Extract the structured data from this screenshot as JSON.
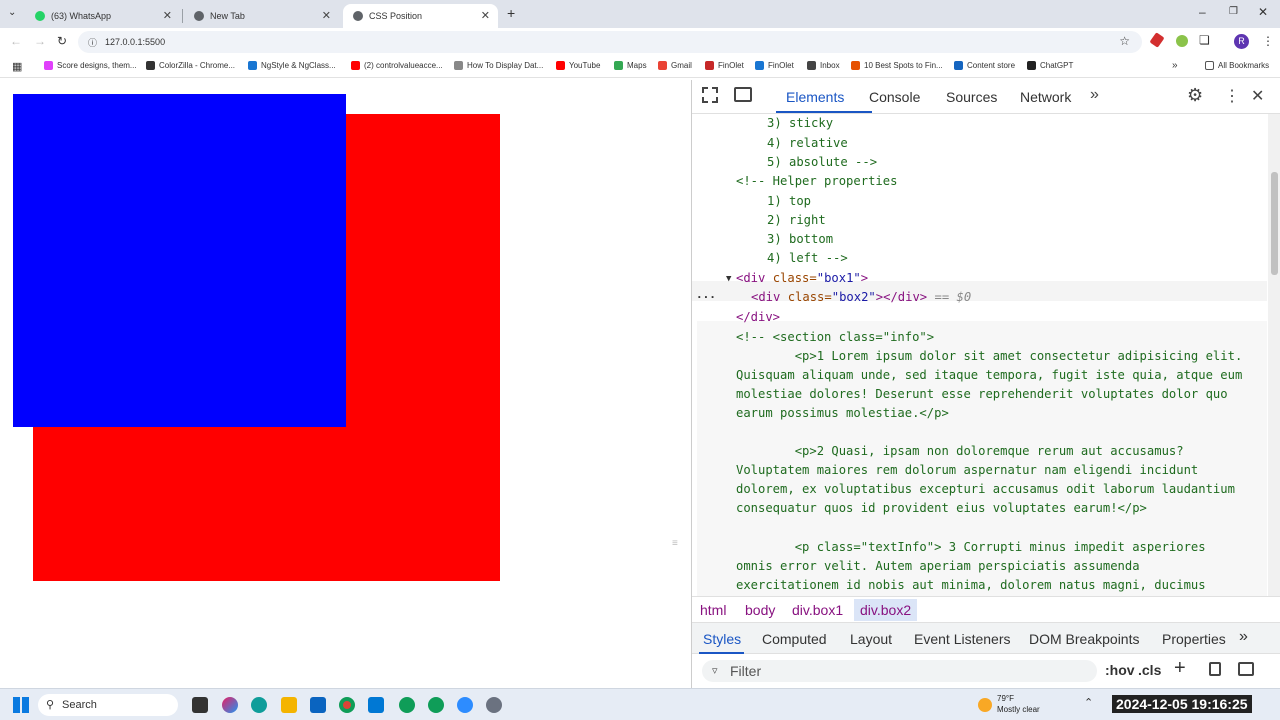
{
  "browser": {
    "tabs": [
      {
        "title": "(63) WhatsApp",
        "color": "#25d366"
      },
      {
        "title": "New Tab",
        "color": "#5f6368"
      },
      {
        "title": "CSS Position",
        "color": "#5f6368"
      }
    ],
    "url": "127.0.0.1:5500",
    "bookmarks": [
      {
        "label": "Score designs, them...",
        "color": "#e040fb"
      },
      {
        "label": "ColorZilla - Chrome...",
        "color": "#333333"
      },
      {
        "label": "NgStyle & NgClass...",
        "color": "#1976d2"
      },
      {
        "label": "(2) controlvalueacce...",
        "color": "#ff0000"
      },
      {
        "label": "How To Display Dat...",
        "color": "#888888"
      },
      {
        "label": "YouTube",
        "color": "#ff0000"
      },
      {
        "label": "Maps",
        "color": "#34a853"
      },
      {
        "label": "Gmail",
        "color": "#ea4335"
      },
      {
        "label": "FinOlet",
        "color": "#c62828"
      },
      {
        "label": "FinOlet",
        "color": "#1976d2"
      },
      {
        "label": "Inbox",
        "color": "#444444"
      },
      {
        "label": "10 Best Spots to Fin...",
        "color": "#e65100"
      },
      {
        "label": "Content store",
        "color": "#1565c0"
      },
      {
        "label": "ChatGPT",
        "color": "#222222"
      }
    ],
    "all_bookmarks": "All Bookmarks",
    "profile_initial": "R"
  },
  "page": {
    "box1_color": "#ff0000",
    "box2_color": "#0000ff"
  },
  "devtools": {
    "tabs": [
      "Elements",
      "Console",
      "Sources",
      "Network"
    ],
    "code_lines": {
      "l1": "3) sticky",
      "l2": "4) relative",
      "l3": "5) absolute -->",
      "l4": "<!-- Helper properties",
      "l5": "1) top",
      "l6": "2) right",
      "l7": "3) bottom",
      "l8": "4) left -->",
      "l9_tag": "<div",
      "l9_attr": " class=",
      "l9_val": "\"box1\"",
      "l9_end": ">",
      "l10_tag": "<div",
      "l10_attr": " class=",
      "l10_val": "\"box2\"",
      "l10_end": "></div>",
      "l10_eq": " == $0",
      "l11": "</div>",
      "c1": "<!-- <section class=\"info\">",
      "c2": "        <p>1 Lorem ipsum dolor sit amet consectetur adipisicing elit.",
      "c3": "Quisquam aliquam unde, sed itaque tempora, fugit iste quia, atque eum",
      "c4": "molestiae dolores! Deserunt esse reprehenderit voluptates dolor quo",
      "c5": "earum possimus molestiae.</p>",
      "c6": "        <p>2 Quasi, ipsam non doloremque rerum aut accusamus?",
      "c7": "Voluptatem maiores rem dolorum aspernatur nam eligendi incidunt",
      "c8": "dolorem, ex voluptatibus excepturi accusamus odit laborum laudantium",
      "c9": "consequatur quos id provident eius voluptates earum!</p>",
      "c10": "        <p class=\"textInfo\"> 3 Corrupti minus impedit asperiores",
      "c11": "omnis error velit. Autem aperiam perspiciatis assumenda",
      "c12": "exercitationem id nobis aut minima, dolorem natus magni, ducimus"
    },
    "breadcrumbs": [
      "html",
      "body",
      "div.box1",
      "div.box2"
    ],
    "panes": [
      "Styles",
      "Computed",
      "Layout",
      "Event Listeners",
      "DOM Breakpoints",
      "Properties"
    ],
    "filter_placeholder": "Filter",
    "hov": ":hov",
    "cls": ".cls"
  },
  "taskbar": {
    "search": "Search",
    "weather_temp": "79°F",
    "weather_desc": "Mostly clear",
    "clock": "2024-12-05  19:16:25"
  }
}
